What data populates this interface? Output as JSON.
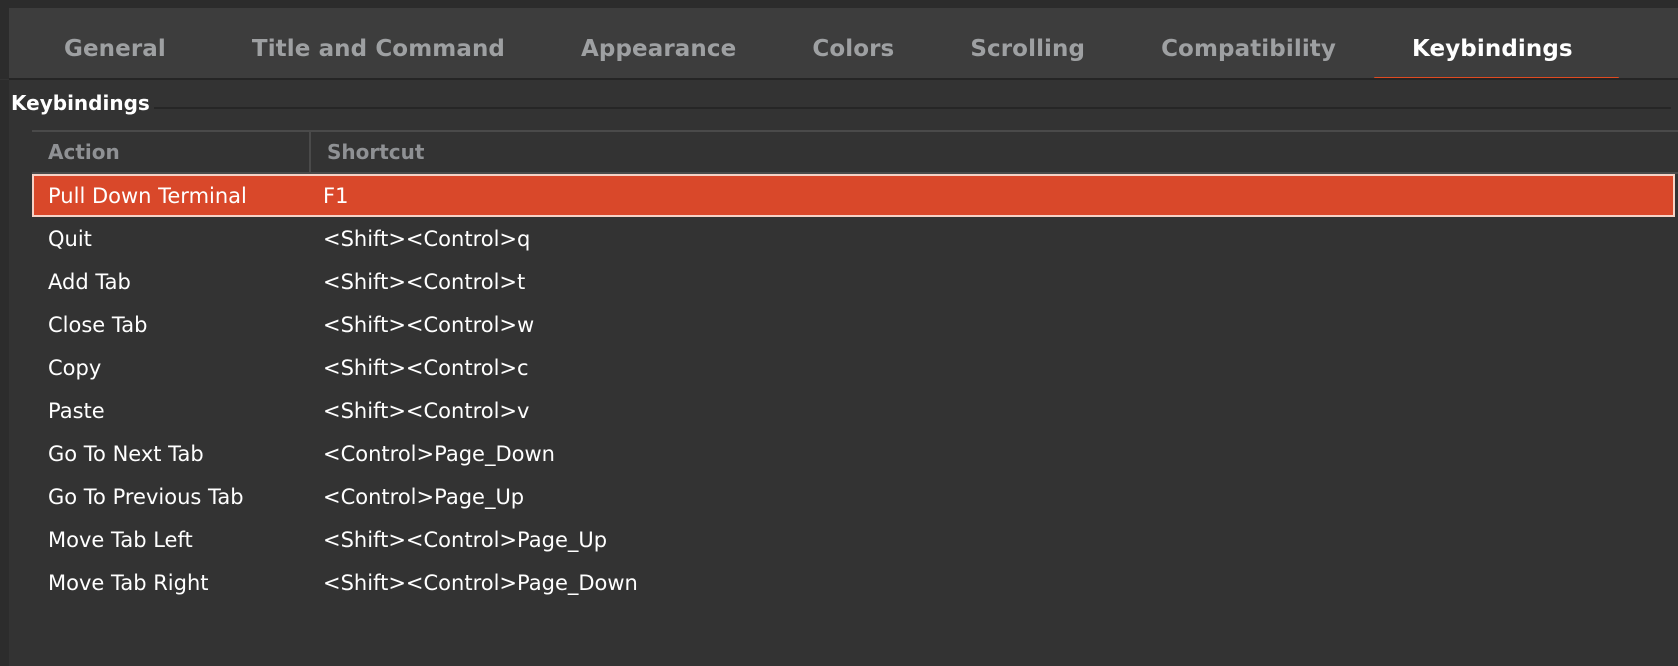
{
  "window": {
    "background_color": "#333333",
    "accent_color": "#d9482a"
  },
  "tabs": [
    {
      "label": "General",
      "active": false
    },
    {
      "label": "Title and Command",
      "active": false
    },
    {
      "label": "Appearance",
      "active": false
    },
    {
      "label": "Colors",
      "active": false
    },
    {
      "label": "Scrolling",
      "active": false
    },
    {
      "label": "Compatibility",
      "active": false
    },
    {
      "label": "Keybindings",
      "active": true
    }
  ],
  "section": {
    "title": "Keybindings"
  },
  "table": {
    "columns": [
      "Action",
      "Shortcut"
    ],
    "rows": [
      {
        "action": "Pull Down Terminal",
        "shortcut": "F1",
        "selected": true
      },
      {
        "action": "Quit",
        "shortcut": "<Shift><Control>q",
        "selected": false
      },
      {
        "action": "Add Tab",
        "shortcut": "<Shift><Control>t",
        "selected": false
      },
      {
        "action": "Close Tab",
        "shortcut": "<Shift><Control>w",
        "selected": false
      },
      {
        "action": "Copy",
        "shortcut": "<Shift><Control>c",
        "selected": false
      },
      {
        "action": "Paste",
        "shortcut": "<Shift><Control>v",
        "selected": false
      },
      {
        "action": "Go To Next Tab",
        "shortcut": "<Control>Page_Down",
        "selected": false
      },
      {
        "action": "Go To Previous Tab",
        "shortcut": "<Control>Page_Up",
        "selected": false
      },
      {
        "action": "Move Tab Left",
        "shortcut": "<Shift><Control>Page_Up",
        "selected": false
      },
      {
        "action": "Move Tab Right",
        "shortcut": "<Shift><Control>Page_Down",
        "selected": false
      }
    ]
  }
}
